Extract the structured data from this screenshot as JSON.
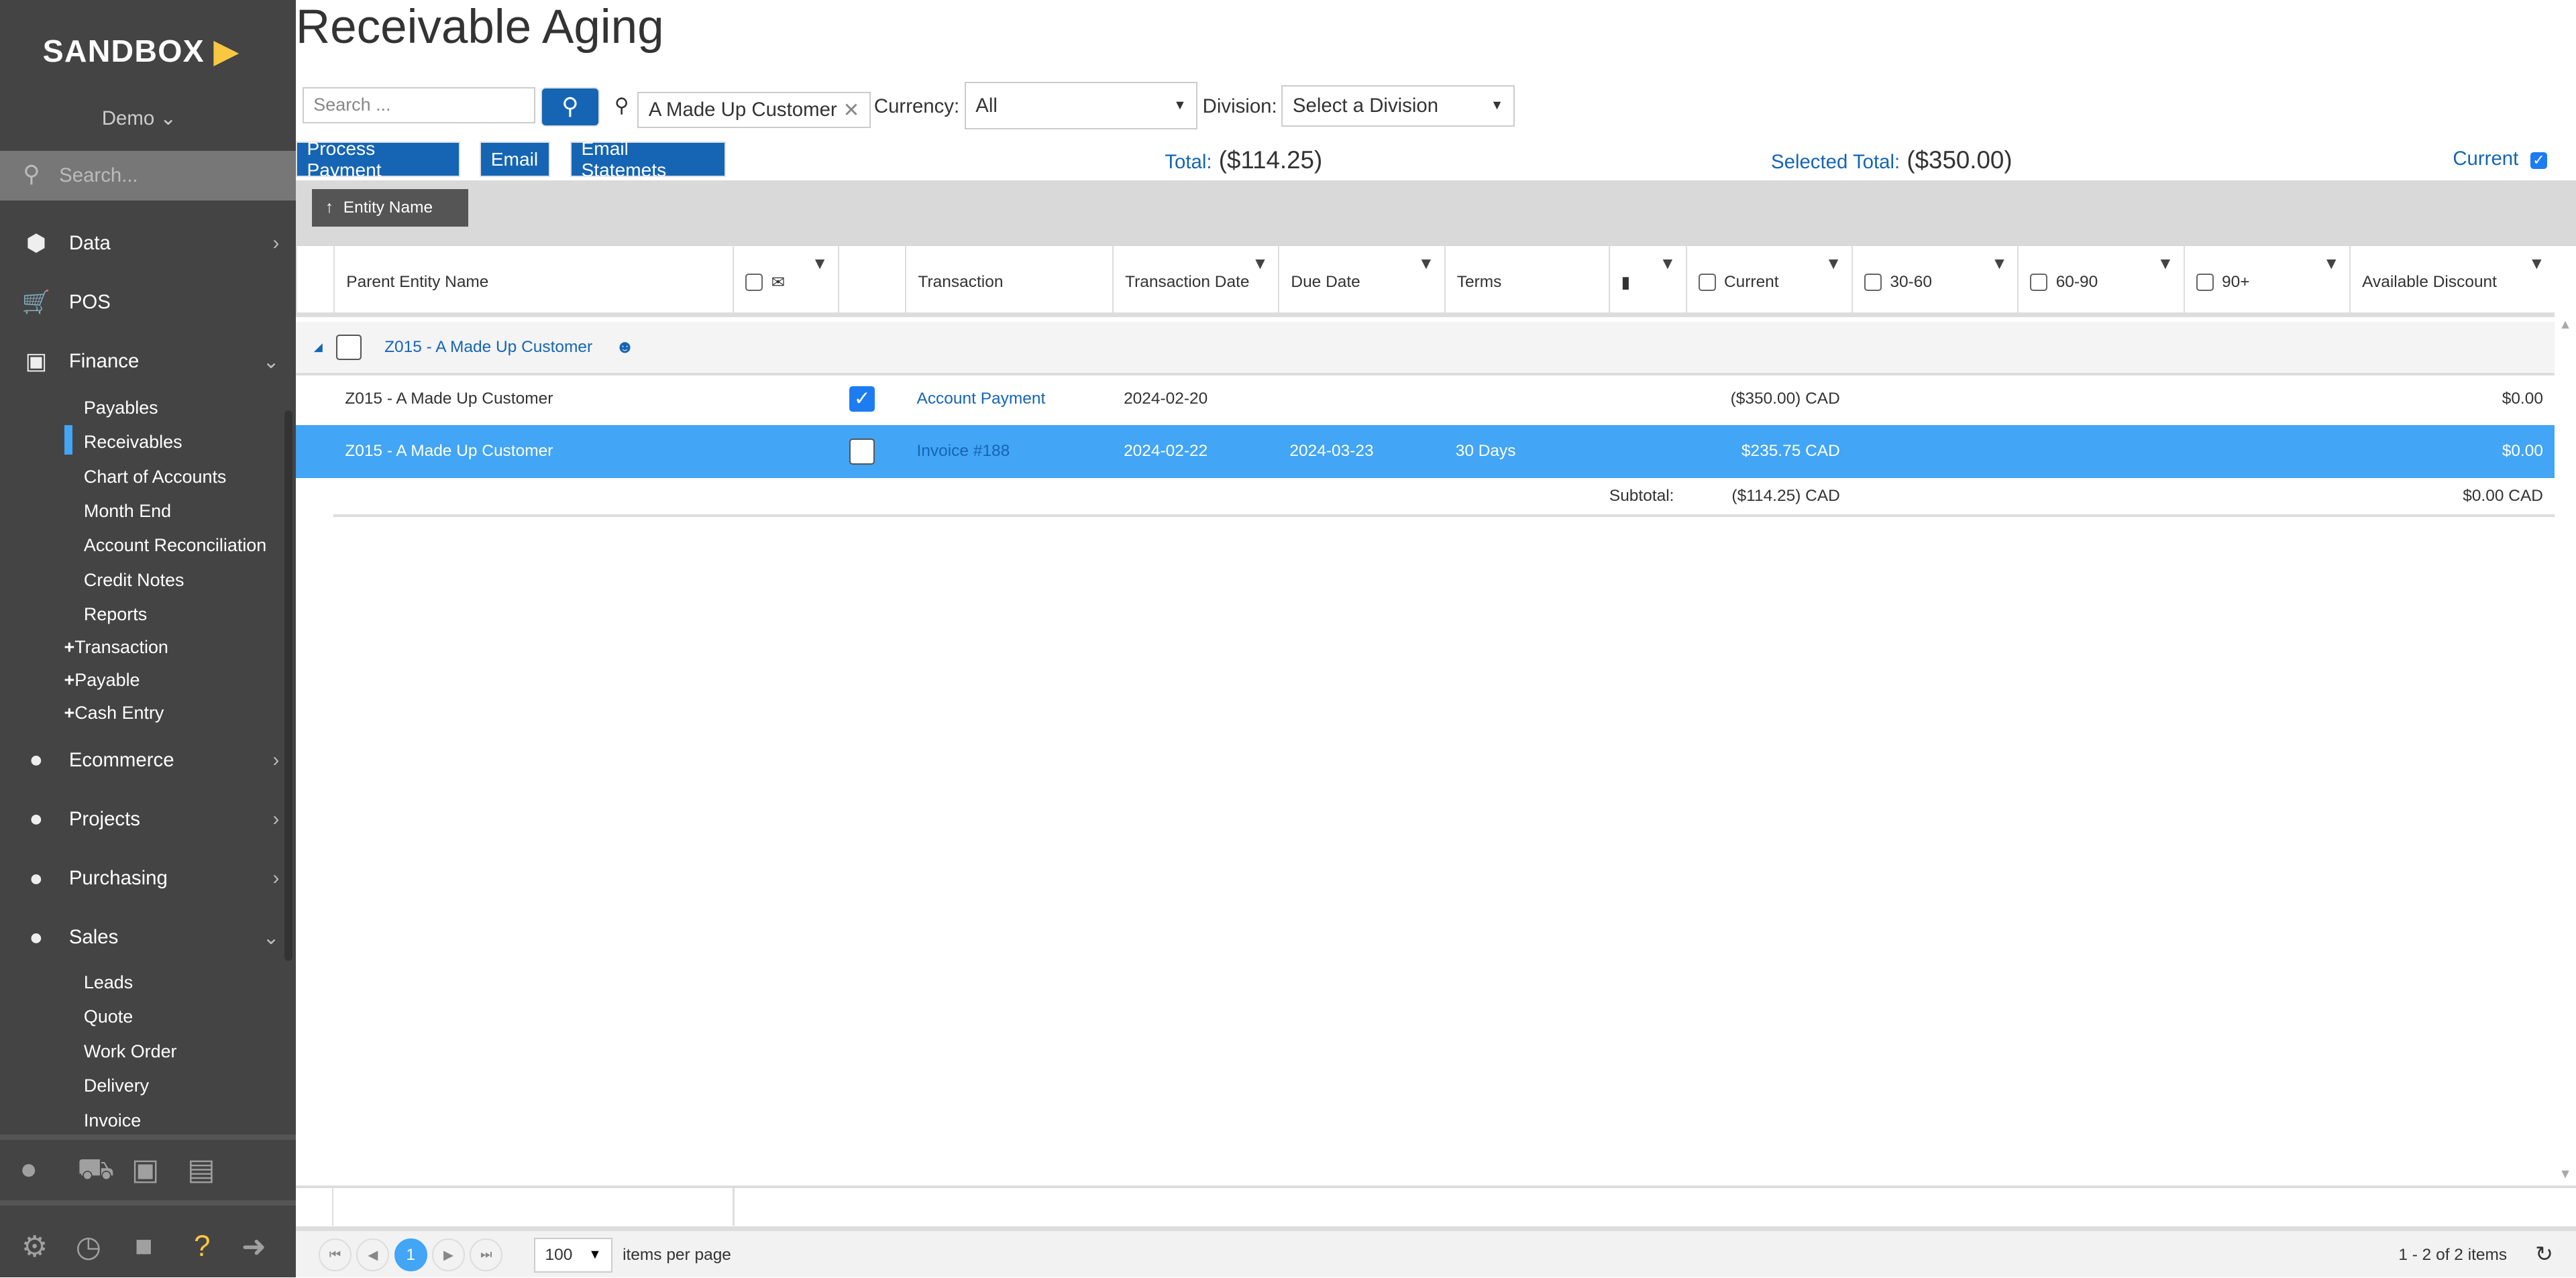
{
  "sidebar": {
    "brand": "SANDBOX",
    "user": "Demo",
    "search_placeholder": "Search...",
    "sections": [
      {
        "label": "Data",
        "icon": "cube-icon"
      },
      {
        "label": "POS",
        "icon": "cart-icon"
      },
      {
        "label": "Finance",
        "icon": "money-icon"
      }
    ],
    "finance_items": [
      "Payables",
      "Receivables",
      "Chart of Accounts",
      "Month End",
      "Account Reconciliation",
      "Credit Notes",
      "Reports"
    ],
    "finance_add": [
      "Transaction",
      "Payable",
      "Cash Entry"
    ],
    "sections2": [
      {
        "label": "Ecommerce"
      },
      {
        "label": "Projects"
      },
      {
        "label": "Purchasing"
      },
      {
        "label": "Sales"
      }
    ],
    "sales_items": [
      "Leads",
      "Quote",
      "Work Order",
      "Delivery",
      "Invoice"
    ]
  },
  "page": {
    "title": "Receivable Aging"
  },
  "toolbar": {
    "search_placeholder": "Search ...",
    "customer_filter": "A Made Up Customer",
    "currency_label": "Currency:",
    "currency_value": "All",
    "division_label": "Division:",
    "division_value": "Select a Division",
    "process_payment": "Process Payment",
    "email": "Email",
    "email_statements": "Email Statemets",
    "total_label": "Total:",
    "total_value": "($114.25)",
    "selected_total_label": "Selected Total:",
    "selected_total_value": "($350.00)",
    "current_label": "Current",
    "current_checked": true
  },
  "grouping": {
    "chip": "Entity Name"
  },
  "grid": {
    "headers": [
      "Parent Entity Name",
      "Transaction",
      "Transaction Date",
      "Due Date",
      "Terms",
      "Current",
      "30-60",
      "60-90",
      "90+",
      "Available Discount"
    ],
    "group": {
      "label": "Z015 - A Made Up Customer"
    },
    "rows": [
      {
        "parent": "Z015 - A Made Up Customer",
        "checked": true,
        "transaction": "Account Payment",
        "date": "2024-02-20",
        "due": "",
        "terms": "",
        "current": "($350.00) CAD",
        "discount": "$0.00"
      },
      {
        "parent": "Z015 - A Made Up Customer",
        "checked": false,
        "transaction": "Invoice #188",
        "date": "2024-02-22",
        "due": "2024-03-23",
        "terms": "30 Days",
        "current": "$235.75 CAD",
        "discount": "$0.00",
        "selected": true
      }
    ],
    "subtotal": {
      "label": "Subtotal:",
      "current": "($114.25) CAD",
      "discount": "$0.00 CAD"
    }
  },
  "pager": {
    "page": "1",
    "page_size": "100",
    "items_per_page": "items per page",
    "summary": "1 - 2 of 2 items"
  },
  "colors": {
    "primary": "#1565b4",
    "selected_row": "#42a5f5",
    "sidebar": "#444444"
  }
}
